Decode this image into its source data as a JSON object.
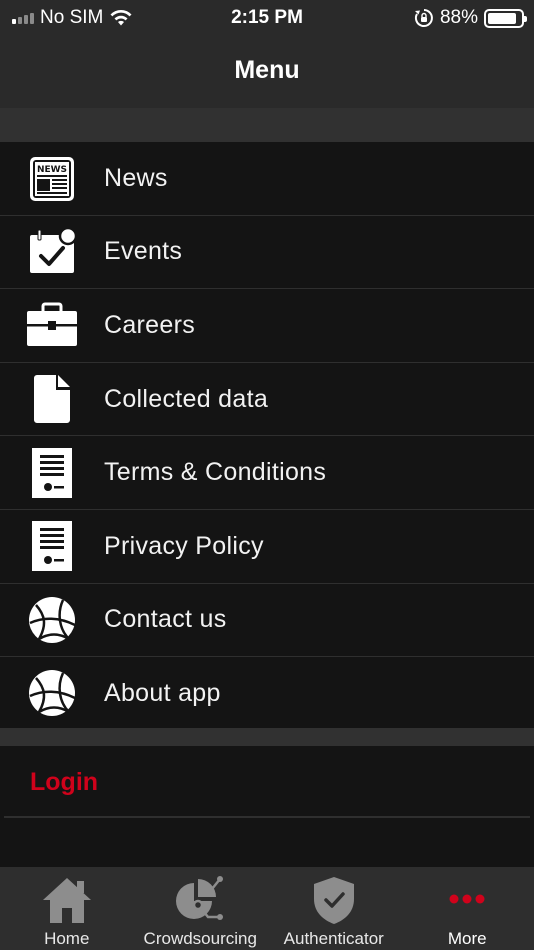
{
  "status_bar": {
    "carrier": "No SIM",
    "time": "2:15 PM",
    "battery_percent": "88%",
    "battery_level": 0.88
  },
  "nav": {
    "title": "Menu"
  },
  "menu": {
    "items": [
      {
        "label": "News",
        "icon": "newspaper-icon"
      },
      {
        "label": "Events",
        "icon": "calendar-check-icon"
      },
      {
        "label": "Careers",
        "icon": "briefcase-icon"
      },
      {
        "label": "Collected data",
        "icon": "document-icon"
      },
      {
        "label": "Terms & Conditions",
        "icon": "certificate-icon"
      },
      {
        "label": "Privacy Policy",
        "icon": "certificate-icon"
      },
      {
        "label": "Contact us",
        "icon": "network-globe-icon"
      },
      {
        "label": "About app",
        "icon": "network-globe-icon"
      }
    ]
  },
  "login": {
    "label": "Login",
    "color": "#d0021b"
  },
  "tabs": [
    {
      "label": "Home",
      "icon": "home-icon"
    },
    {
      "label": "Crowdsourcing",
      "icon": "crowdsourcing-icon"
    },
    {
      "label": "Authenticator",
      "icon": "shield-check-icon"
    },
    {
      "label": "More",
      "icon": "more-dots-icon",
      "active": true
    }
  ],
  "colors": {
    "accent": "#d0021b",
    "background": "#141414",
    "bar": "#2a2a2a"
  }
}
